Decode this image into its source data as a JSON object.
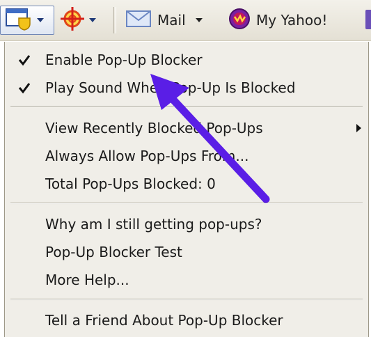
{
  "toolbar": {
    "popup_blocker_icon": "popup-blocker-icon",
    "target_icon": "crosshair-target-icon",
    "mail_label": "Mail",
    "yahoo_label": "My Yahoo!"
  },
  "menu": {
    "items": [
      {
        "label": "Enable Pop-Up Blocker",
        "checked": true
      },
      {
        "label": "Play Sound When Pop-Up Is Blocked",
        "checked": true
      },
      {
        "label": "View Recently Blocked Pop-Ups",
        "submenu": true
      },
      {
        "label": "Always Allow Pop-Ups From..."
      },
      {
        "label": "Total Pop-Ups Blocked: 0"
      },
      {
        "label": "Why am I still getting pop-ups?"
      },
      {
        "label": "Pop-Up Blocker Test"
      },
      {
        "label": "More Help..."
      },
      {
        "label": "Tell a Friend About Pop-Up Blocker"
      }
    ]
  },
  "colors": {
    "annotation_arrow": "#5a1ee6",
    "menu_background": "#f0eee8"
  }
}
